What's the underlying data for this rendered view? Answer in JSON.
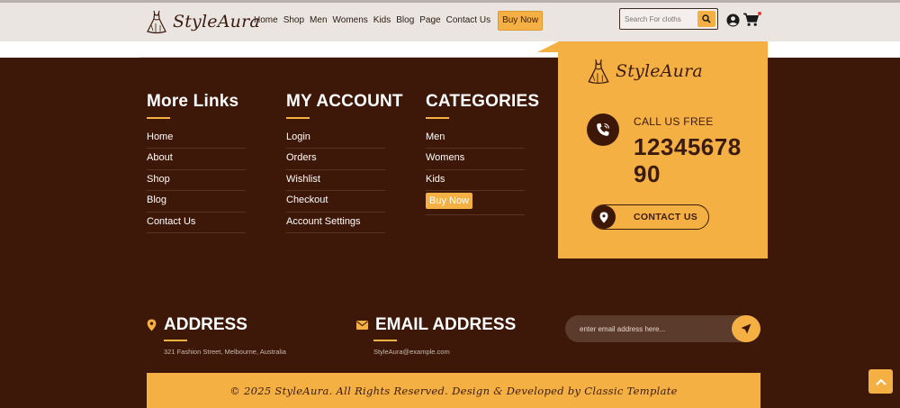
{
  "brand": {
    "name": "StyleAura"
  },
  "header": {
    "nav": [
      "Home",
      "Shop",
      "Men",
      "Womens",
      "Kids",
      "Blog",
      "Page",
      "Contact Us"
    ],
    "buy_now": "Buy Now",
    "search_placeholder": "Search For cloths"
  },
  "footer": {
    "more_links": {
      "title": "More Links",
      "items": [
        "Home",
        "About",
        "Shop",
        "Blog",
        "Contact Us"
      ]
    },
    "my_account": {
      "title": "MY ACCOUNT",
      "items": [
        "Login",
        "Orders",
        "Wishlist",
        "Checkout",
        "Account Settings"
      ]
    },
    "categories": {
      "title": "CATEGORIES",
      "items": [
        "Men",
        "Womens",
        "Kids"
      ],
      "buy_now": "Buy Now"
    },
    "contact_card": {
      "call_label": "CALL US FREE",
      "phone": "1234567890",
      "contact_button": "CONTACT US"
    },
    "address": {
      "title": "ADDRESS",
      "value": "321 Fashion Street, Melbourne, Australia"
    },
    "email": {
      "title": "EMAIL ADDRESS",
      "value": "StyleAura@example.com"
    },
    "newsletter": {
      "placeholder": "enter email address here..."
    },
    "copyright": "© 2025 StyleAura. All Rights Reserved. Design & Developed by Classic Template"
  },
  "colors": {
    "accent": "#f5b043",
    "dark": "#3d1708",
    "header_bg": "#ebe5e1"
  }
}
